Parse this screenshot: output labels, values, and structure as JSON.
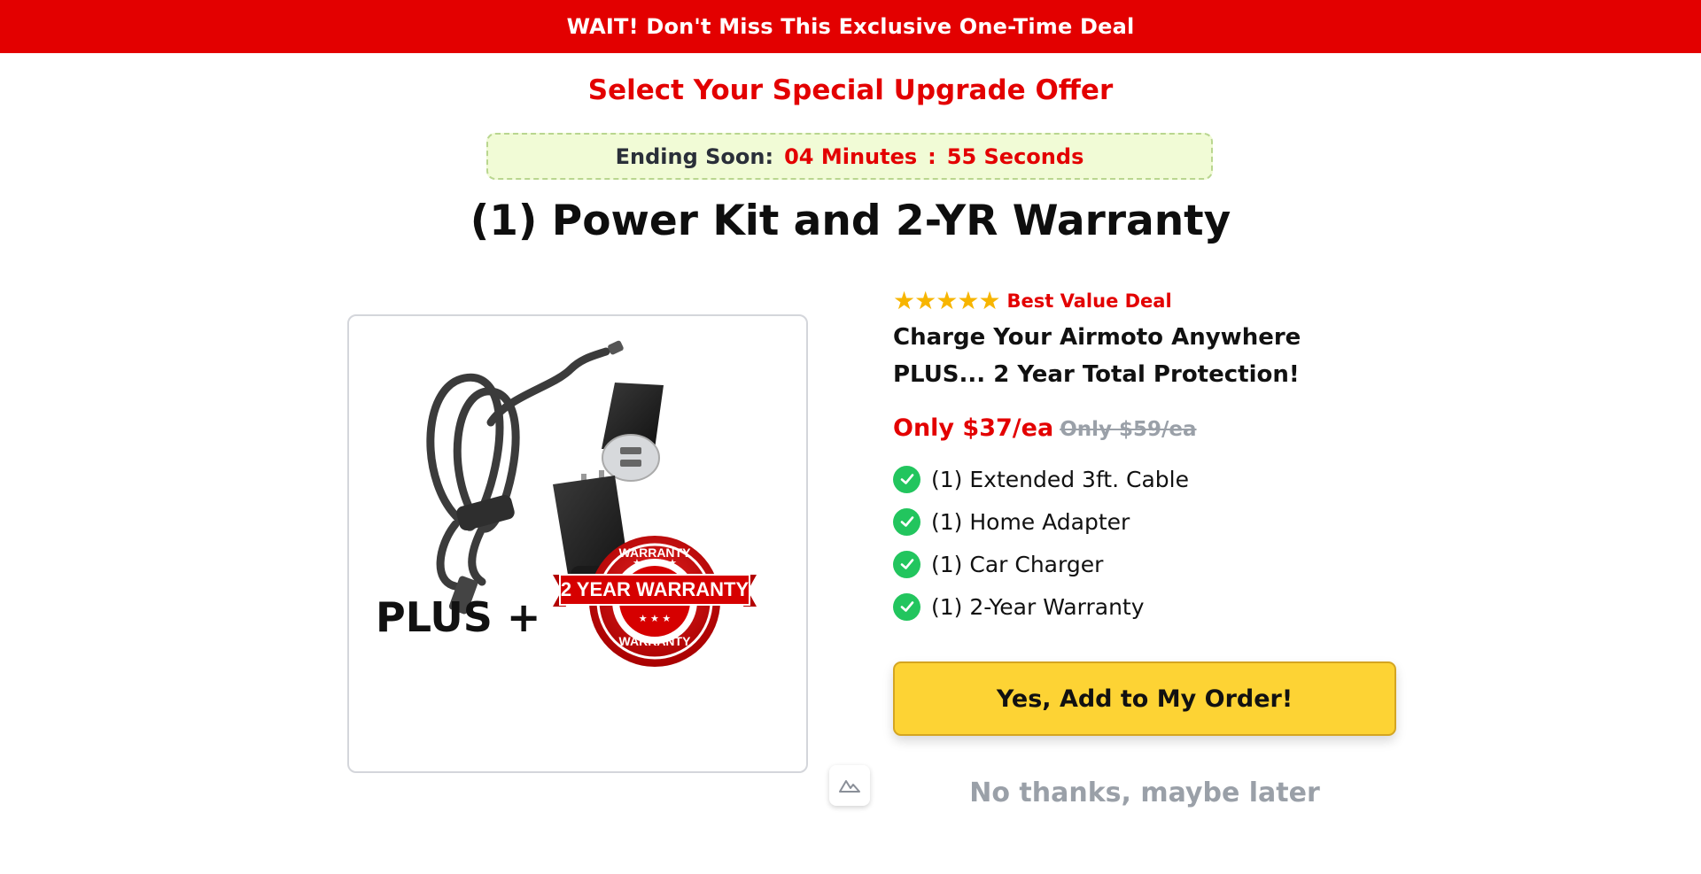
{
  "banner": {
    "text": "WAIT! Don't Miss This Exclusive One-Time Deal",
    "color": "#e30000"
  },
  "subhead": "Select Your Special Upgrade Offer",
  "timer": {
    "label": "Ending Soon:",
    "minutes": "04 Minutes",
    "separator": ":",
    "seconds": "55 Seconds"
  },
  "title": "(1) Power Kit and 2-YR Warranty",
  "product_image": {
    "plus_text": "PLUS +",
    "badge_main": "2 YEAR WARRANTY",
    "badge_top": "WARRANTY",
    "badge_bottom": "WARRANTY"
  },
  "offer": {
    "rating_stars": 5,
    "rating_label": "Best Value Deal",
    "headline": "Charge Your Airmoto Anywhere PLUS... 2 Year Total Protection!",
    "price": "Only $37/ea",
    "old_price": "Only $59/ea",
    "features": [
      "(1) Extended 3ft. Cable",
      "(1) Home Adapter",
      "(1) Car Charger",
      "(1) 2-Year Warranty"
    ]
  },
  "cta": {
    "label": "Yes, Add to My Order!",
    "color": "#fdd334"
  },
  "decline": "No thanks, maybe later",
  "icons": {
    "star": "star-icon",
    "check": "check-circle-icon",
    "float": "mountain-logo-icon"
  }
}
